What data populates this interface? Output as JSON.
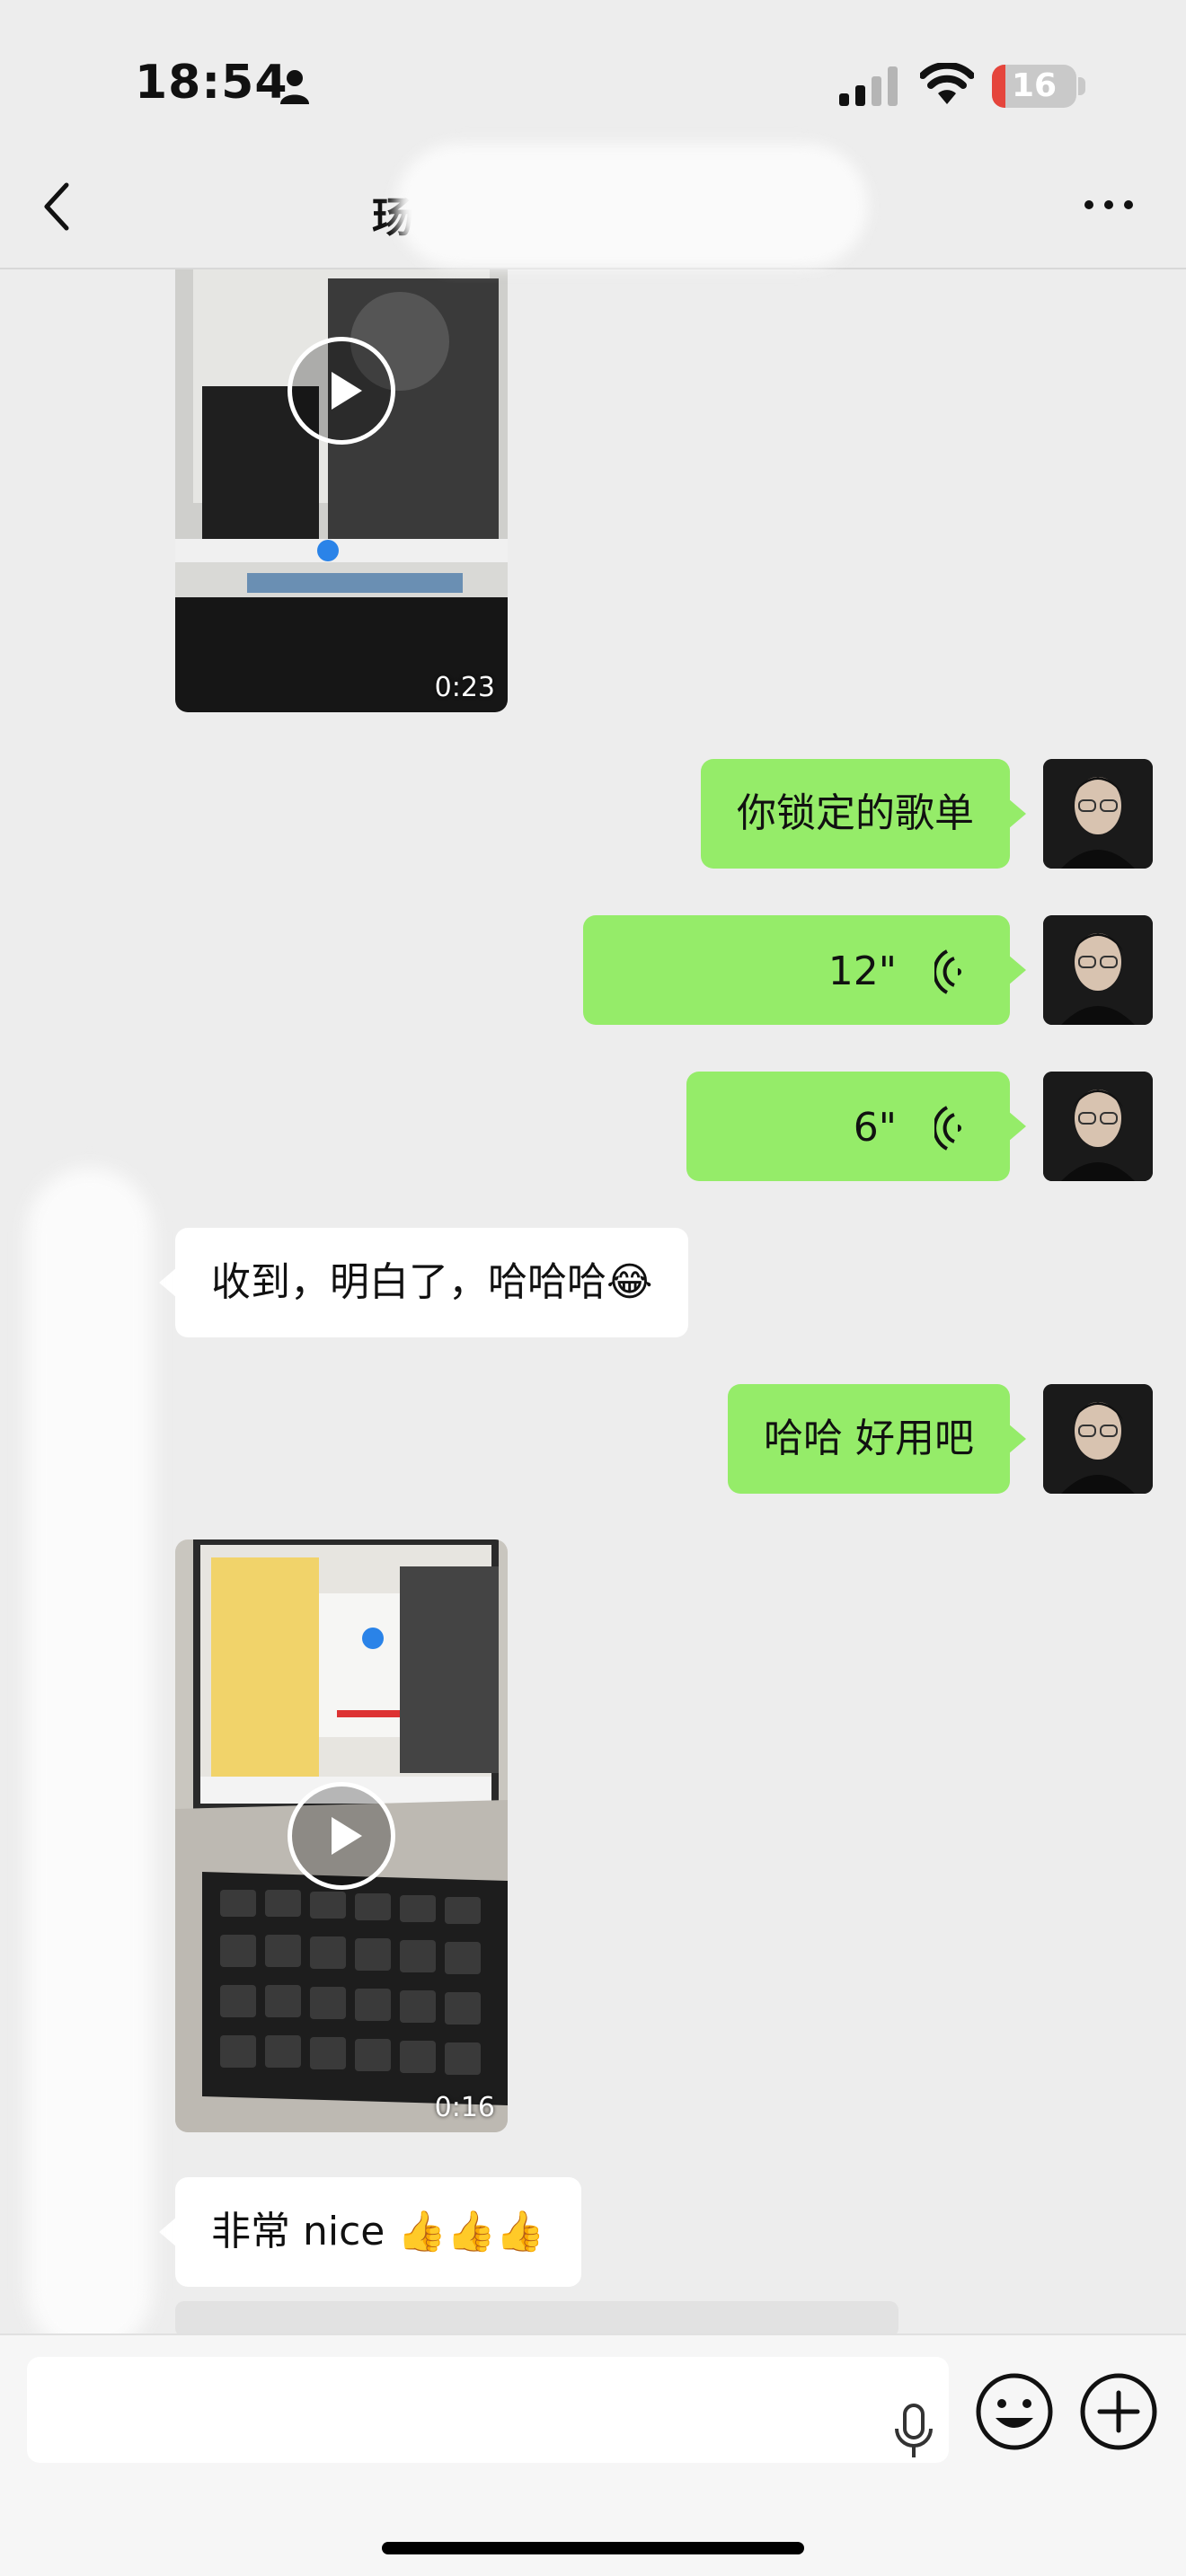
{
  "status_bar": {
    "time": "18:54",
    "battery_level": "16",
    "battery_color": "#e5453c",
    "icons": [
      "person-icon",
      "signal-icon",
      "wifi-icon",
      "battery-icon"
    ]
  },
  "header": {
    "title": "玚",
    "back_icon": "chevron-left-icon",
    "more_icon": "ellipsis-icon"
  },
  "messages": {
    "video_1": {
      "duration": "0:23"
    },
    "text_1": {
      "text": "你锁定的歌单"
    },
    "voice_1": {
      "duration": "12\""
    },
    "voice_2": {
      "duration": "6\""
    },
    "text_2": {
      "text": "收到，明白了，哈哈哈😂"
    },
    "text_3": {
      "text": "哈哈 好用吧"
    },
    "video_2": {
      "duration": "0:16"
    },
    "text_4": {
      "text": "非常 nice 👍👍👍"
    }
  },
  "input_bar": {
    "icons": [
      "microphone-icon",
      "emoji-icon",
      "plus-icon"
    ]
  },
  "colors": {
    "outgoing_bubble": "#95ec69",
    "incoming_bubble": "#ffffff",
    "background": "#ededed"
  }
}
